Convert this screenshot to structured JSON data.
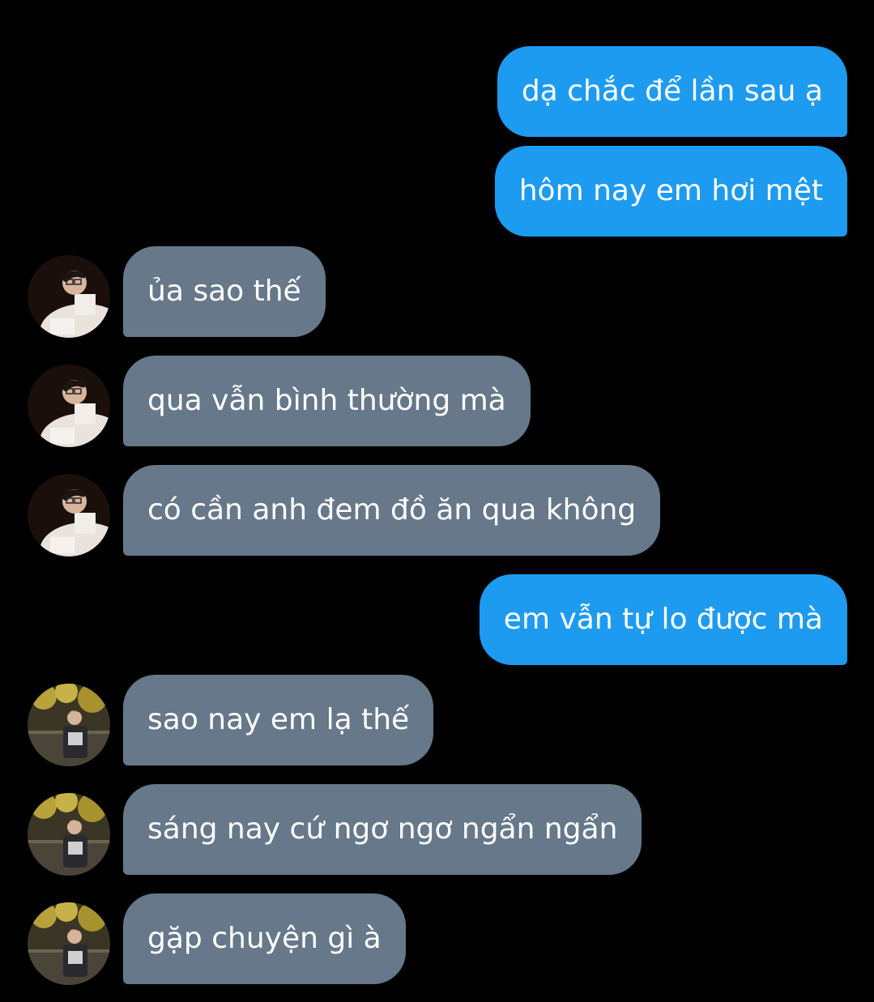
{
  "messages": [
    {
      "text": "dạ chắc để lần sau ạ",
      "direction": "outgoing"
    },
    {
      "text": "hôm nay em hơi mệt",
      "direction": "outgoing"
    },
    {
      "text": "ủa sao thế",
      "direction": "incoming",
      "avatar": "avatar-1"
    },
    {
      "text": "qua vẫn bình thường mà",
      "direction": "incoming",
      "avatar": "avatar-1"
    },
    {
      "text": "có cần anh đem đồ ăn qua không",
      "direction": "incoming",
      "avatar": "avatar-1"
    },
    {
      "text": "em vẫn tự lo được mà",
      "direction": "outgoing"
    },
    {
      "text": "sao nay em lạ thế",
      "direction": "incoming",
      "avatar": "avatar-2"
    },
    {
      "text": "sáng nay cứ ngơ ngơ ngẩn ngẩn",
      "direction": "incoming",
      "avatar": "avatar-2"
    },
    {
      "text": "gặp chuyện gì à",
      "direction": "incoming",
      "avatar": "avatar-2"
    }
  ],
  "colors": {
    "background": "#000000",
    "outgoing_bubble": "#1d9bf0",
    "incoming_bubble": "#66788a",
    "text": "#ffffff"
  }
}
